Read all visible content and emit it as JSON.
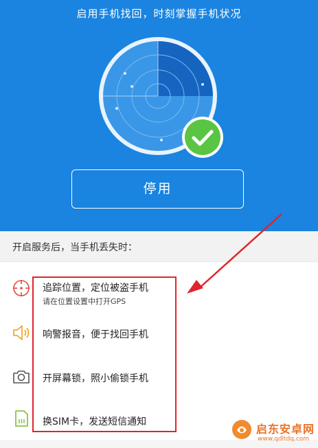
{
  "header": {
    "title": "启用手机找回，时刻掌握手机状况"
  },
  "status": {
    "radar_icon": "radar-scan",
    "check_icon": "check-circle"
  },
  "action": {
    "stop_label": "停用"
  },
  "section": {
    "label": "开启服务后，当手机丢失时："
  },
  "features": [
    {
      "icon": "crosshair-icon",
      "title": "追踪位置，定位被盗手机",
      "subtitle": "请在位置设置中打开GPS"
    },
    {
      "icon": "speaker-icon",
      "title": "响警报音，便于找回手机"
    },
    {
      "icon": "camera-icon",
      "title": "开屏幕锁，照小偷锁手机"
    },
    {
      "icon": "sim-card-icon",
      "title": "换SIM卡，发送短信通知"
    }
  ],
  "watermark": {
    "name": "启东安卓网",
    "url": "www.qdltdq.com"
  },
  "colors": {
    "hero_bg": "#1a84e0",
    "highlight_red": "#e0242b",
    "check_green": "#5ac542"
  }
}
